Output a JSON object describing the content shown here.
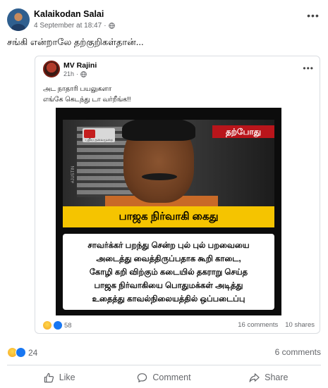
{
  "post": {
    "author": "Kalaikodan Salai",
    "timestamp": "4 September at 18:47",
    "separator": "·",
    "text": "சங்கி என்றாலே தற்குறிகள்தான்...",
    "more_glyph": "•••"
  },
  "shared": {
    "author": "MV Rajini",
    "timestamp": "21h",
    "separator": "·",
    "more_glyph": "•••",
    "line1": "அட நாதாரி பயலுகளா",
    "line2": "எங்கே கெடந்து டா வர்றீங்க!!",
    "image": {
      "channel": "புதிய தலைமுறை",
      "tag": "தற்போது",
      "watermark": "#JUSTIN",
      "headline": "பாஜக நிர்வாகி கைது",
      "caption": [
        "சாவர்க்கர் பறந்து சென்ற புல் புல் பறவையை",
        "அடைத்து வைத்திருப்பதாக கூறி காடை,",
        "கோழி கறி விற்கும் கடையில் தகராறு செய்த",
        "பாஜக நிர்வாகியை பொதுமக்கள் அடித்து",
        "உதைத்து காவல்நிலையத்தில் ஒப்படைப்பு"
      ]
    },
    "reaction_count": "58",
    "comments": "16 comments",
    "shares": "10 shares"
  },
  "footer": {
    "reaction_count": "24",
    "comments": "6 comments"
  },
  "actions": {
    "like": "Like",
    "comment": "Comment",
    "share": "Share"
  },
  "colors": {
    "accent": "#1877f2",
    "meta": "#65676b",
    "headline_bg": "#f5c400",
    "tag_bg": "#b9151b"
  },
  "icons": [
    "globe-icon",
    "more-icon",
    "haha-emoji-icon",
    "like-emoji-icon",
    "like-icon",
    "comment-icon",
    "share-icon"
  ]
}
